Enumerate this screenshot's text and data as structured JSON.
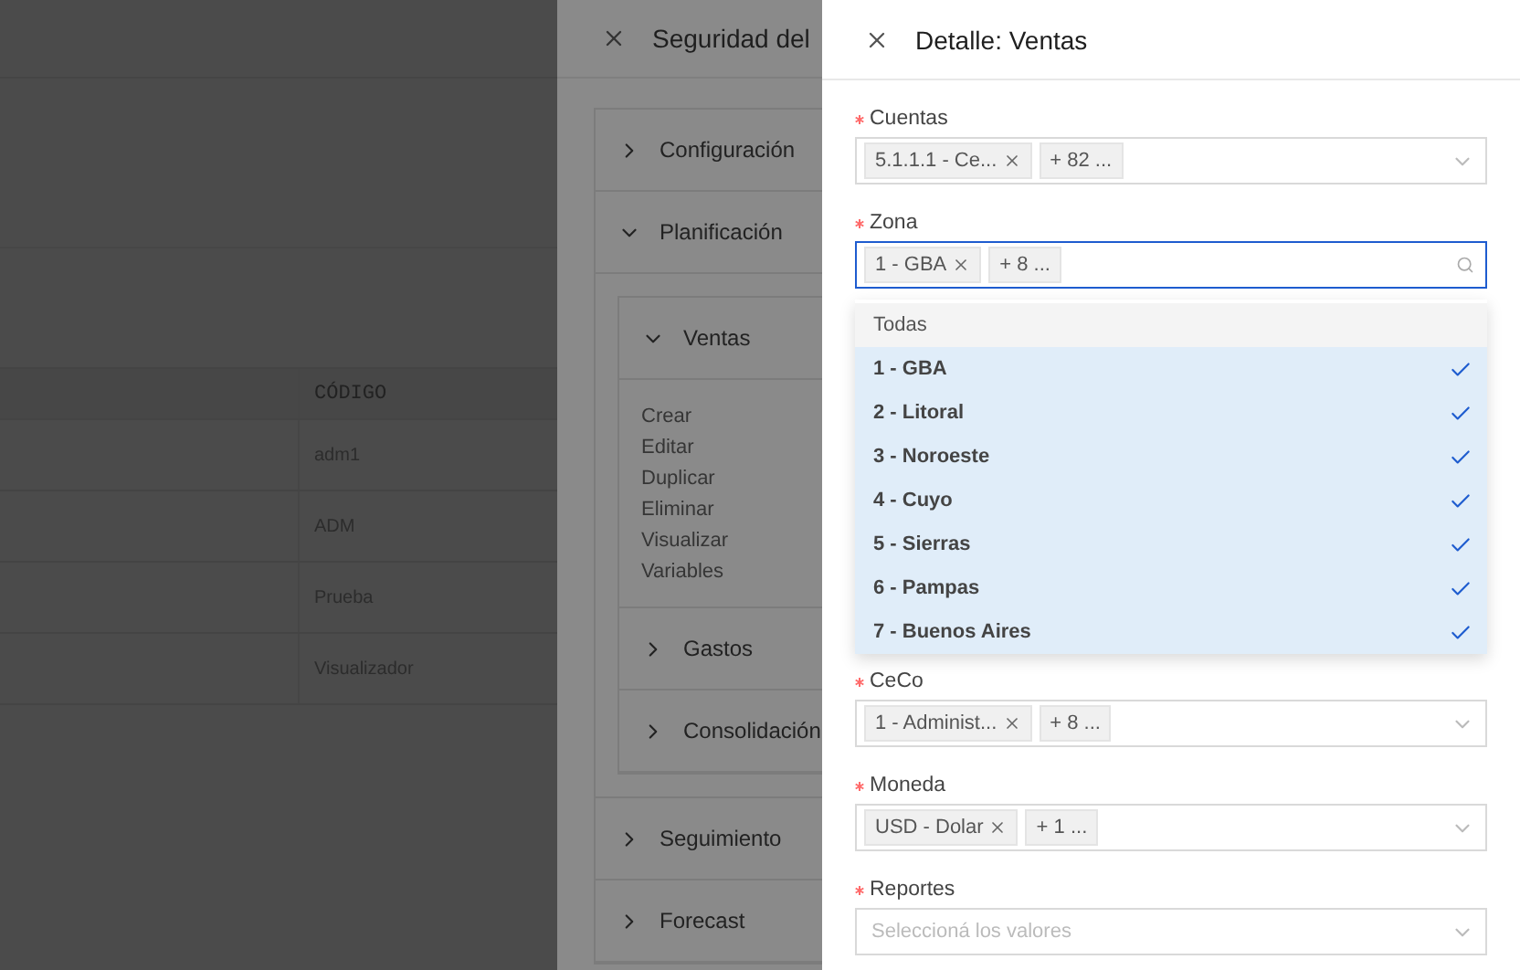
{
  "background_table": {
    "columns": [
      "CÓDIGO"
    ],
    "rows": [
      [
        "adm1"
      ],
      [
        "ADM"
      ],
      [
        "Prueba"
      ],
      [
        "Visualizador"
      ]
    ]
  },
  "security_panel": {
    "title": "Seguridad del",
    "sections": [
      {
        "label": "Configuración",
        "expanded": false
      },
      {
        "label": "Planificación",
        "expanded": true,
        "children": [
          {
            "label": "Ventas",
            "expanded": true,
            "actions": [
              "Crear",
              "Editar",
              "Duplicar",
              "Eliminar",
              "Visualizar",
              "Variables"
            ]
          },
          {
            "label": "Gastos",
            "expanded": false
          },
          {
            "label": "Consolidación",
            "expanded": false
          }
        ]
      },
      {
        "label": "Seguimiento",
        "expanded": false
      },
      {
        "label": "Forecast",
        "expanded": false
      }
    ]
  },
  "detail_panel": {
    "title": "Detalle: Ventas",
    "fields": [
      {
        "label": "Cuentas",
        "required": true,
        "open": false,
        "tags": [
          {
            "text": "5.1.1.1 - Ce...",
            "removable": true
          },
          {
            "text": "+ 82 ...",
            "removable": false
          }
        ]
      },
      {
        "label": "Zona",
        "required": true,
        "open": true,
        "tags": [
          {
            "text": "1 - GBA",
            "removable": true
          },
          {
            "text": "+ 8 ...",
            "removable": false
          }
        ],
        "dropdown": {
          "all_option": "Todas",
          "options": [
            {
              "label": "1 - GBA",
              "selected": true
            },
            {
              "label": "2 - Litoral",
              "selected": true
            },
            {
              "label": "3 - Noroeste",
              "selected": true
            },
            {
              "label": "4 - Cuyo",
              "selected": true
            },
            {
              "label": "5 - Sierras",
              "selected": true
            },
            {
              "label": "6 - Pampas",
              "selected": true
            },
            {
              "label": "7 - Buenos Aires",
              "selected": true
            }
          ]
        }
      },
      {
        "label": "CeCo",
        "required": true,
        "open": false,
        "tags": [
          {
            "text": "1 - Administ...",
            "removable": true
          },
          {
            "text": "+ 8 ...",
            "removable": false
          }
        ]
      },
      {
        "label": "Moneda",
        "required": true,
        "open": false,
        "tags": [
          {
            "text": "USD - Dolar",
            "removable": true
          },
          {
            "text": "+ 1 ...",
            "removable": false
          }
        ]
      },
      {
        "label": "Reportes",
        "required": true,
        "open": false,
        "placeholder": "Seleccioná los valores"
      }
    ]
  }
}
